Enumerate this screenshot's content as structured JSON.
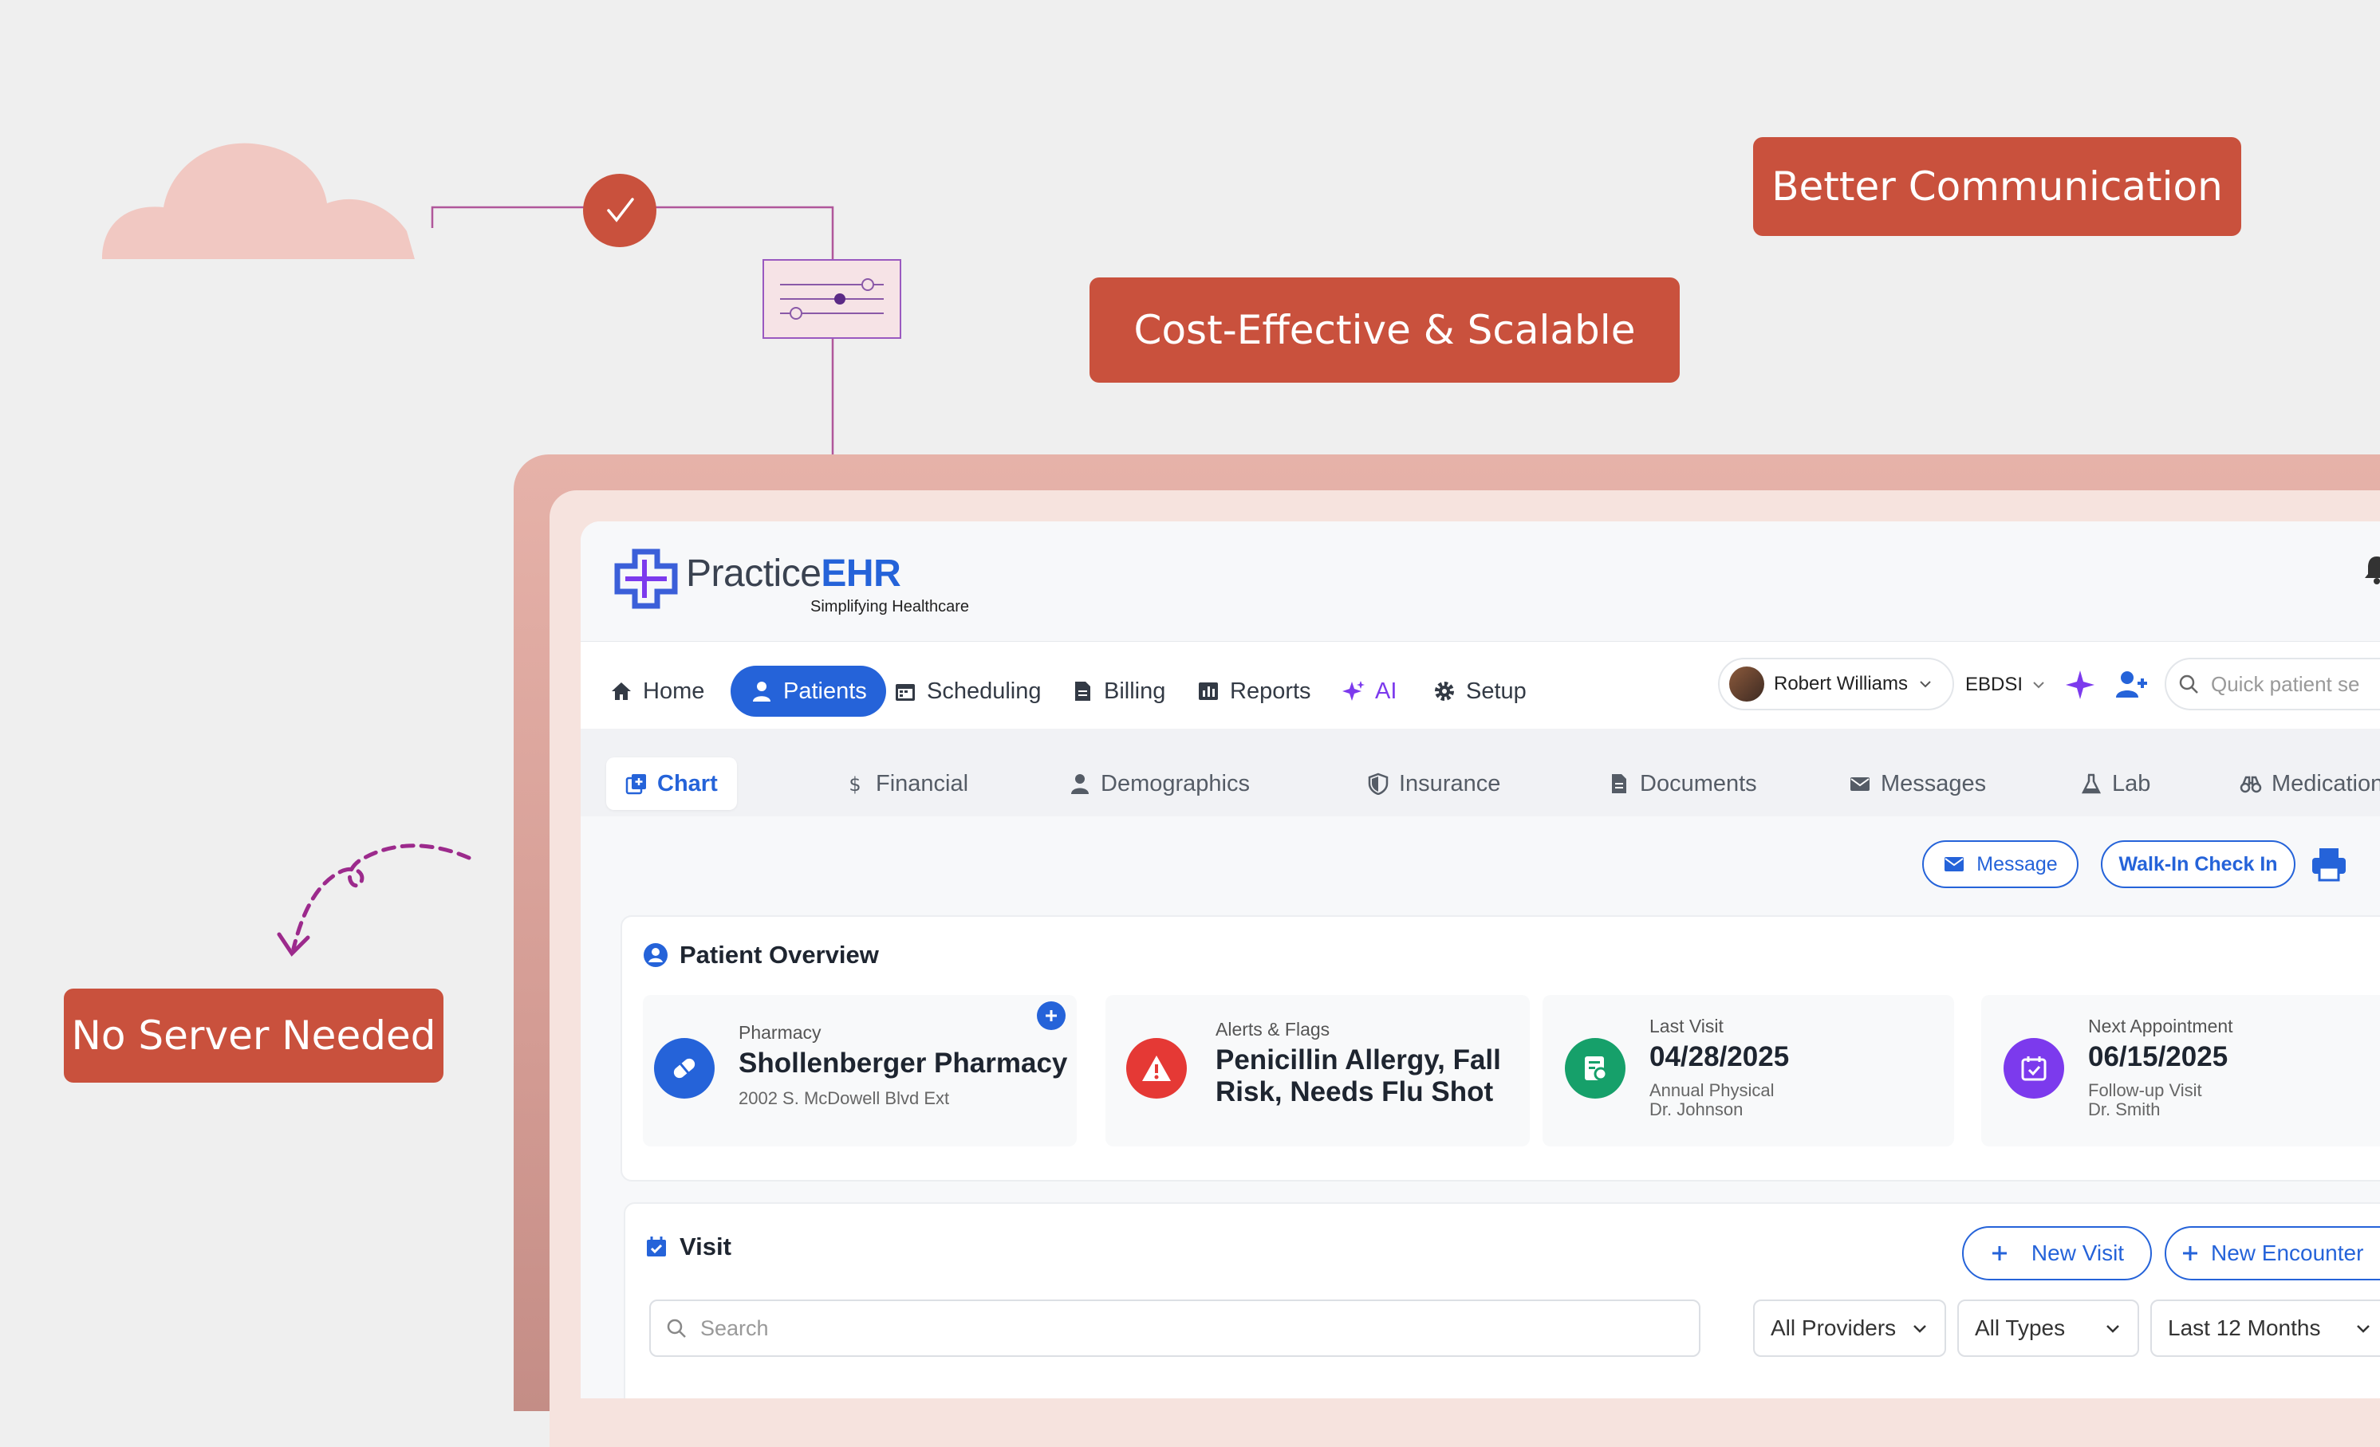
{
  "badges": {
    "better_communication": "Better Communication",
    "cost_effective": "Cost-Effective & Scalable",
    "no_server": "No Server Needed"
  },
  "app": {
    "brand": {
      "name_part1": "Practice",
      "name_part2": "EHR",
      "tagline": "Simplifying Healthcare"
    },
    "nav": {
      "home": "Home",
      "patients": "Patients",
      "scheduling": "Scheduling",
      "billing": "Billing",
      "reports": "Reports",
      "ai": "AI",
      "setup": "Setup"
    },
    "user": {
      "name": "Robert Williams",
      "org": "EBDSI"
    },
    "search": {
      "placeholder": "Quick patient se"
    },
    "tabs": {
      "chart": "Chart",
      "financial": "Financial",
      "demographics": "Demographics",
      "insurance": "Insurance",
      "documents": "Documents",
      "messages": "Messages",
      "lab": "Lab",
      "medication": "Medication"
    },
    "actions": {
      "message": "Message",
      "walk_in": "Walk-In Check In"
    },
    "overview": {
      "title": "Patient Overview",
      "pharmacy": {
        "label": "Pharmacy",
        "name": "Shollenberger Pharmacy",
        "address": "2002 S. McDowell Blvd Ext"
      },
      "alerts": {
        "label": "Alerts & Flags",
        "line1": "Penicillin Allergy, Fall",
        "line2": "Risk, Needs Flu Shot"
      },
      "last_visit": {
        "label": "Last Visit",
        "date": "04/28/2025",
        "type": "Annual Physical",
        "doctor": "Dr. Johnson"
      },
      "next_appt": {
        "label": "Next Appointment",
        "date": "06/15/2025",
        "type": "Follow-up Visit",
        "doctor": "Dr. Smith"
      }
    },
    "visit": {
      "title": "Visit",
      "new_visit": "New Visit",
      "new_encounter": "New Encounter",
      "search_placeholder": "Search",
      "filters": {
        "providers": "All Providers",
        "types": "All Types",
        "range": "Last 12 Months"
      }
    }
  },
  "colors": {
    "accent": "#2563d9",
    "badge": "#c9513d",
    "alert": "#e53935",
    "visit": "#16a06a",
    "appt": "#7c3aed"
  }
}
